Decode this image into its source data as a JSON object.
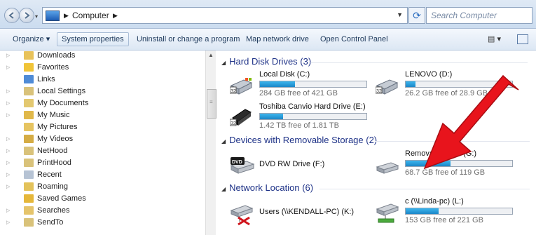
{
  "address": {
    "crumbs": [
      "Computer"
    ],
    "search_placeholder": "Search Computer"
  },
  "toolbar": {
    "organize": "Organize ▾",
    "system_properties": "System properties",
    "uninstall": "Uninstall or change a program",
    "map_drive": "Map network drive",
    "control_panel": "Open Control Panel",
    "view_icon": "▤ ▾"
  },
  "nav": {
    "items": [
      "Downloads",
      "Favorites",
      "Links",
      "Local Settings",
      "My Documents",
      "My Music",
      "My Pictures",
      "My Videos",
      "NetHood",
      "PrintHood",
      "Recent",
      "Roaming",
      "Saved Games",
      "Searches",
      "SendTo"
    ]
  },
  "groups": {
    "hdd": "Hard Disk Drives (3)",
    "removable": "Devices with Removable Storage (2)",
    "network": "Network Location (6)"
  },
  "drives": {
    "c": {
      "name": "Local Disk (C:)",
      "free": "284 GB free of 421 GB",
      "used_fraction": 0.33
    },
    "d": {
      "name": "LENOVO (D:)",
      "free": "26.2 GB free of 28.9 GB",
      "used_fraction": 0.09
    },
    "e": {
      "name": "Toshiba Canvio Hard Drive (E:)",
      "free": "1.42 TB free of 1.81 TB",
      "used_fraction": 0.22
    },
    "f": {
      "name": "DVD RW Drive (F:)"
    },
    "g": {
      "name": "Removable Disk (G:)",
      "free": "68.7 GB free of 119 GB",
      "used_fraction": 0.42
    },
    "k": {
      "name": "Users (\\\\KENDALL-PC) (K:)"
    },
    "l": {
      "name": "c (\\\\Linda-pc) (L:)",
      "free": "153 GB free of 221 GB",
      "used_fraction": 0.31
    }
  },
  "dvd_badge": "DVD",
  "colors": {
    "accent": "#1e3287",
    "bar": "#26a0df",
    "arrow": "#e8141c"
  }
}
